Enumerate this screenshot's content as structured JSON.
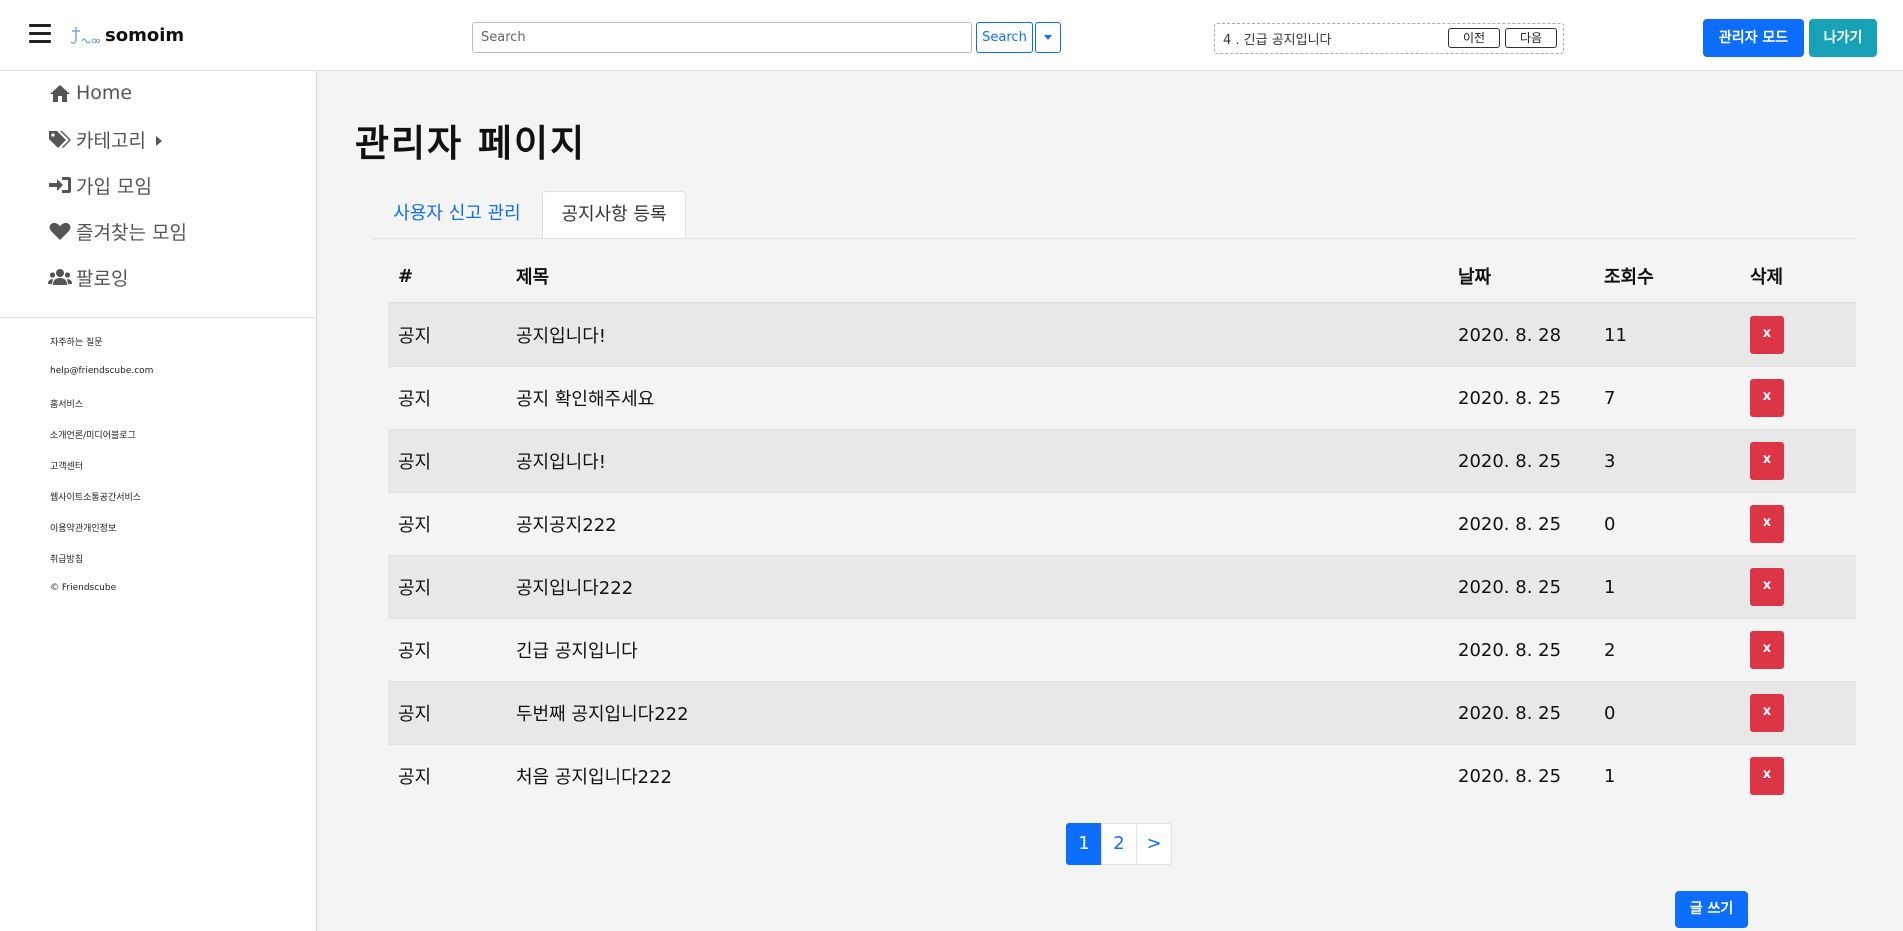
{
  "header": {
    "app_name": "somoim",
    "search": {
      "placeholder": "Search",
      "value": "",
      "button_label": "Search"
    },
    "ticker": {
      "text": "4 . 긴급 공지입니다",
      "prev_label": "이전",
      "next_label": "다음"
    },
    "admin_mode_label": "관리자 모드",
    "exit_label": "나가기"
  },
  "sidebar": {
    "nav": [
      {
        "label": "Home",
        "icon": "home-icon"
      },
      {
        "label": "카테고리",
        "icon": "tags-icon"
      },
      {
        "label": "가입 모임",
        "icon": "sign-in-icon"
      },
      {
        "label": "즐겨찾는 모임",
        "icon": "heart-icon"
      },
      {
        "label": "팔로잉",
        "icon": "users-icon"
      }
    ],
    "footer_links": [
      "자주하는 질문",
      "help@friendscube.com",
      "홈서비스",
      "소개언론/미디어블로그",
      "고객센터",
      "웹사이트소통공간서비스",
      "이용약관개인정보",
      "취급방침",
      "© Friendscube"
    ]
  },
  "main": {
    "page_title": "관리자 페이지",
    "tabs": [
      {
        "label": "사용자 신고 관리",
        "active": false
      },
      {
        "label": "공지사항 등록",
        "active": true
      }
    ],
    "table": {
      "columns": [
        "#",
        "제목",
        "날짜",
        "조회수",
        "삭제"
      ],
      "rows": [
        {
          "category": "공지",
          "title": "공지입니다!",
          "date": "2020. 8. 28",
          "views": "11",
          "delete": "x"
        },
        {
          "category": "공지",
          "title": "공지 확인해주세요",
          "date": "2020. 8. 25",
          "views": "7",
          "delete": "x"
        },
        {
          "category": "공지",
          "title": "공지입니다!",
          "date": "2020. 8. 25",
          "views": "3",
          "delete": "x"
        },
        {
          "category": "공지",
          "title": "공지공지222",
          "date": "2020. 8. 25",
          "views": "0",
          "delete": "x"
        },
        {
          "category": "공지",
          "title": "공지입니다222",
          "date": "2020. 8. 25",
          "views": "1",
          "delete": "x"
        },
        {
          "category": "공지",
          "title": "긴급 공지입니다",
          "date": "2020. 8. 25",
          "views": "2",
          "delete": "x"
        },
        {
          "category": "공지",
          "title": "두번째 공지입니다222",
          "date": "2020. 8. 25",
          "views": "0",
          "delete": "x"
        },
        {
          "category": "공지",
          "title": "처음 공지입니다222",
          "date": "2020. 8. 25",
          "views": "1",
          "delete": "x"
        }
      ]
    },
    "pagination": {
      "pages": [
        "1",
        "2"
      ],
      "next_label": ">",
      "current": "1"
    },
    "write_label": "글 쓰기"
  },
  "colors": {
    "primary": "#0d6efd",
    "danger": "#dc3545",
    "info": "#17a2b8"
  }
}
